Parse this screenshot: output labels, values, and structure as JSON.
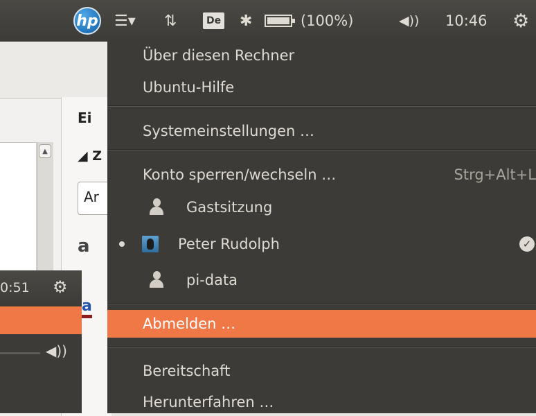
{
  "panel": {
    "battery_label": "(100%)",
    "battery_level": 1.0,
    "clock": "10:46",
    "keyboard_layout": "De"
  },
  "menu": {
    "items": [
      {
        "label": "Über diesen Rechner"
      },
      {
        "label": "Ubuntu-Hilfe"
      },
      {
        "label": "Systemeinstellungen …"
      },
      {
        "label": "Konto sperren/wechseln …",
        "accel": "Strg+Alt+L"
      },
      {
        "label": "Gastsitzung"
      },
      {
        "label": "Peter Rudolph"
      },
      {
        "label": "pi-data"
      },
      {
        "label": "Abmelden …"
      },
      {
        "label": "Bereitschaft"
      },
      {
        "label": "Herunterfahren …"
      }
    ]
  },
  "background_app": {
    "panel_title": "Ei",
    "section_label": "◢ Z",
    "input_text": "Ar",
    "font_sample": "a",
    "underline_sample": "a"
  },
  "inset_panel": {
    "clock_fragment": "0:51"
  },
  "colors": {
    "panel_bg": "#3c3b37",
    "highlight": "#f07746",
    "menu_text": "#dfdbd2"
  }
}
